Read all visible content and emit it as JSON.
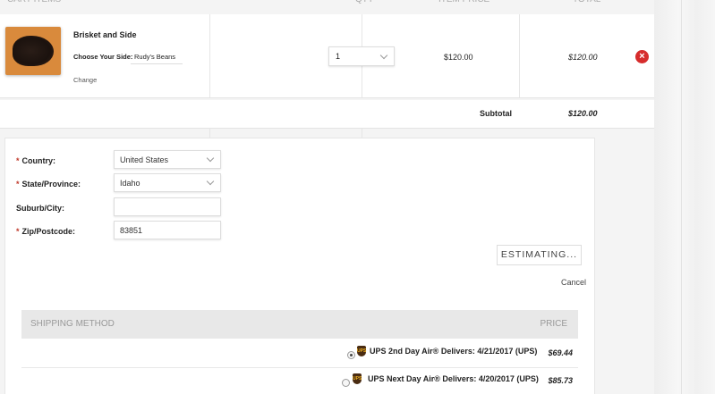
{
  "cart": {
    "headers": {
      "items": "CART ITEMS",
      "qty": "QTY",
      "item_price": "ITEM PRICE",
      "total": "TOTAL"
    },
    "item": {
      "name": "Brisket and Side",
      "side_label": "Choose Your Side:",
      "side_value": "Rudy's Beans",
      "change": "Change",
      "qty": "1",
      "price": "$120.00",
      "total": "$120.00",
      "remove_icon": "remove-circle-icon"
    },
    "subtotal_label": "Subtotal",
    "subtotal_value": "$120.00"
  },
  "estimator": {
    "fields": {
      "country_label": "Country:",
      "country_value": "United States",
      "state_label": "State/Province:",
      "state_value": "Idaho",
      "city_label": "Suburb/City:",
      "city_value": "",
      "zip_label": "Zip/Postcode:",
      "zip_value": "83851"
    },
    "estimate_button": "ESTIMATING...",
    "cancel": "Cancel"
  },
  "shipping": {
    "header_method": "SHIPPING METHOD",
    "header_price": "PRICE",
    "options": [
      {
        "label": "UPS 2nd Day Air® Delivers: 4/21/2017 (UPS)",
        "price": "$69.44",
        "selected": true
      },
      {
        "label": "UPS Next Day Air® Delivers: 4/20/2017 (UPS)",
        "price": "$85.73",
        "selected": false
      }
    ]
  },
  "colors": {
    "accent_red": "#d62c2c",
    "required_red": "#c0392b"
  }
}
